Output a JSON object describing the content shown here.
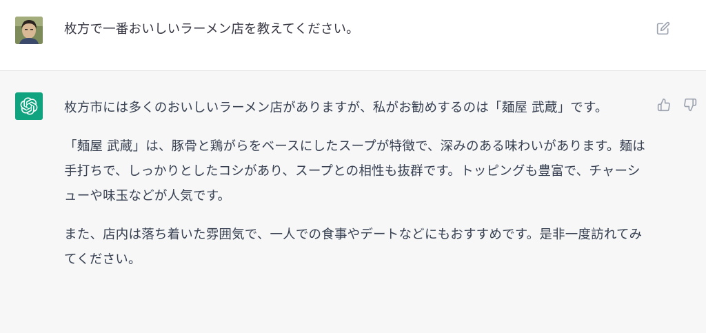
{
  "user_message": {
    "text": "枚方で一番おいしいラーメン店を教えてください。",
    "avatar": "user-photo-avatar"
  },
  "assistant_message": {
    "avatar": "openai-logo-icon",
    "avatar_color": "#10a37f",
    "paragraphs": [
      "枚方市には多くのおいしいラーメン店がありますが、私がお勧めするのは「麺屋 武蔵」です。",
      "「麺屋 武蔵」は、豚骨と鶏がらをベースにしたスープが特徴で、深みのある味わいがあります。麺は手打ちで、しっかりとしたコシがあり、スープとの相性も抜群です。トッピングも豊富で、チャーシューや味玉などが人気です。",
      "また、店内は落ち着いた雰囲気で、一人での食事やデートなどにもおすすめです。是非一度訪れてみてください。"
    ]
  },
  "icons": {
    "edit": "edit-icon",
    "thumbs_up": "thumbs-up-icon",
    "thumbs_down": "thumbs-down-icon"
  }
}
